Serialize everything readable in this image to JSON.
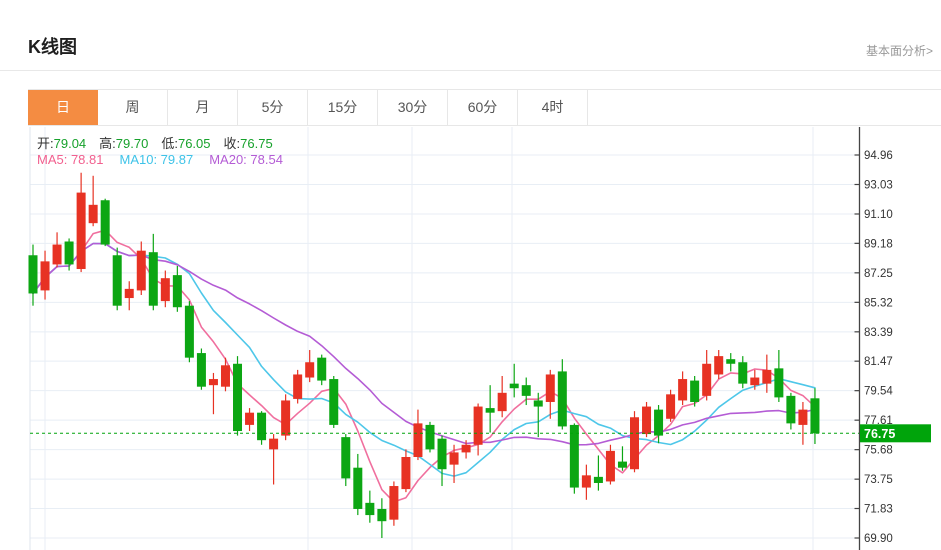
{
  "header": {
    "title": "K线图",
    "link_label": "基本面分析>"
  },
  "tabs": {
    "items": [
      "日",
      "周",
      "月",
      "5分",
      "15分",
      "30分",
      "60分",
      "4时"
    ],
    "selected_index": 0,
    "selected_color": "#f48c42"
  },
  "info": {
    "ohlc": [
      {
        "label": "开:",
        "value": "79.04"
      },
      {
        "label": "高:",
        "value": "79.70"
      },
      {
        "label": "低:",
        "value": "76.05"
      },
      {
        "label": "收:",
        "value": "76.75"
      }
    ],
    "value_color": "#16a12b",
    "ma": [
      {
        "label": "MA5:",
        "value": "78.81",
        "color": "#f2608f"
      },
      {
        "label": "MA10:",
        "value": "79.87",
        "color": "#3ec3e8"
      },
      {
        "label": "MA20:",
        "value": "78.54",
        "color": "#b45cd5"
      }
    ]
  },
  "chart_data": {
    "type": "candlestick",
    "title": "K线图 daily candles with MA5/MA10/MA20 overlays",
    "legend": [
      "MA5",
      "MA10",
      "MA20"
    ],
    "ma_periods": [
      5,
      10,
      20
    ],
    "y_axis": {
      "tick_labels": [
        "94.96",
        "93.03",
        "91.10",
        "89.18",
        "87.25",
        "85.32",
        "83.39",
        "81.47",
        "79.54",
        "77.61",
        "75.68",
        "73.75",
        "71.83",
        "69.90"
      ],
      "min": 69.9,
      "max": 94.96
    },
    "current_price": {
      "label": "76.75",
      "value": 76.75
    },
    "colors": {
      "up": "#e73223",
      "down": "#0ca613",
      "ma5": "#f06f9e",
      "ma10": "#4ec7e9",
      "ma20": "#b45cd5",
      "badge": "#00a40b",
      "grid": "#e8eef5",
      "axis": "#444444"
    },
    "candles_format": [
      "open",
      "high",
      "low",
      "close"
    ],
    "candles": [
      [
        88.4,
        89.1,
        85.1,
        85.9
      ],
      [
        86.1,
        88.7,
        85.5,
        88.0
      ],
      [
        87.8,
        89.9,
        87.6,
        89.1
      ],
      [
        89.3,
        89.5,
        87.4,
        87.8
      ],
      [
        87.5,
        93.8,
        87.3,
        92.5
      ],
      [
        90.5,
        93.6,
        90.3,
        91.7
      ],
      [
        92.0,
        92.1,
        89.0,
        89.1
      ],
      [
        88.4,
        88.9,
        84.8,
        85.1
      ],
      [
        85.6,
        86.7,
        84.8,
        86.2
      ],
      [
        86.1,
        89.3,
        85.8,
        88.7
      ],
      [
        88.6,
        89.8,
        84.8,
        85.1
      ],
      [
        85.4,
        87.4,
        85.0,
        86.9
      ],
      [
        87.1,
        87.7,
        84.7,
        85.0
      ],
      [
        85.1,
        85.4,
        81.4,
        81.7
      ],
      [
        82.0,
        82.3,
        79.6,
        79.8
      ],
      [
        79.9,
        80.7,
        78.0,
        80.3
      ],
      [
        79.8,
        81.7,
        79.5,
        81.2
      ],
      [
        81.3,
        81.8,
        76.6,
        76.9
      ],
      [
        77.3,
        78.4,
        76.9,
        78.1
      ],
      [
        78.1,
        78.2,
        76.0,
        76.3
      ],
      [
        75.7,
        76.7,
        73.4,
        76.4
      ],
      [
        76.6,
        79.3,
        76.3,
        78.9
      ],
      [
        79.0,
        80.9,
        78.7,
        80.6
      ],
      [
        80.4,
        82.2,
        80.1,
        81.4
      ],
      [
        81.7,
        81.9,
        79.9,
        80.2
      ],
      [
        80.3,
        80.5,
        77.1,
        77.3
      ],
      [
        76.5,
        76.7,
        73.3,
        73.8
      ],
      [
        74.5,
        75.4,
        71.4,
        71.8
      ],
      [
        72.2,
        73.0,
        70.9,
        71.4
      ],
      [
        71.8,
        72.5,
        69.9,
        71.0
      ],
      [
        71.1,
        73.6,
        70.7,
        73.3
      ],
      [
        73.1,
        75.7,
        72.9,
        75.2
      ],
      [
        75.2,
        78.3,
        75.0,
        77.4
      ],
      [
        77.3,
        77.5,
        75.5,
        75.7
      ],
      [
        76.4,
        76.6,
        73.3,
        74.4
      ],
      [
        74.7,
        76.0,
        73.5,
        75.5
      ],
      [
        75.5,
        76.3,
        75.1,
        76.0
      ],
      [
        76.0,
        78.7,
        75.3,
        78.5
      ],
      [
        78.4,
        79.9,
        76.8,
        78.1
      ],
      [
        78.2,
        80.5,
        77.8,
        79.4
      ],
      [
        80.0,
        81.3,
        79.1,
        79.7
      ],
      [
        79.9,
        80.4,
        78.6,
        79.2
      ],
      [
        78.9,
        79.4,
        76.5,
        78.5
      ],
      [
        78.8,
        80.9,
        77.7,
        80.6
      ],
      [
        80.8,
        81.6,
        77.0,
        77.2
      ],
      [
        77.3,
        77.4,
        72.8,
        73.2
      ],
      [
        73.2,
        74.7,
        72.4,
        74.0
      ],
      [
        73.9,
        75.3,
        73.0,
        73.5
      ],
      [
        73.6,
        76.0,
        73.4,
        75.6
      ],
      [
        74.9,
        75.9,
        74.3,
        74.5
      ],
      [
        74.4,
        78.2,
        74.2,
        77.8
      ],
      [
        76.7,
        78.8,
        76.5,
        78.5
      ],
      [
        78.3,
        78.6,
        76.1,
        76.6
      ],
      [
        77.7,
        79.6,
        77.5,
        79.3
      ],
      [
        78.9,
        80.8,
        78.6,
        80.3
      ],
      [
        80.2,
        80.5,
        78.5,
        78.8
      ],
      [
        79.2,
        82.2,
        78.9,
        81.3
      ],
      [
        80.6,
        82.2,
        80.3,
        81.8
      ],
      [
        81.6,
        82.0,
        80.8,
        81.3
      ],
      [
        81.4,
        81.8,
        79.7,
        80.0
      ],
      [
        79.9,
        80.9,
        79.6,
        80.4
      ],
      [
        80.0,
        81.9,
        79.4,
        80.9
      ],
      [
        81.0,
        82.2,
        78.8,
        79.1
      ],
      [
        79.2,
        79.4,
        77.0,
        77.4
      ],
      [
        77.3,
        78.8,
        76.0,
        78.3
      ],
      [
        79.04,
        79.7,
        76.05,
        76.75
      ]
    ]
  }
}
